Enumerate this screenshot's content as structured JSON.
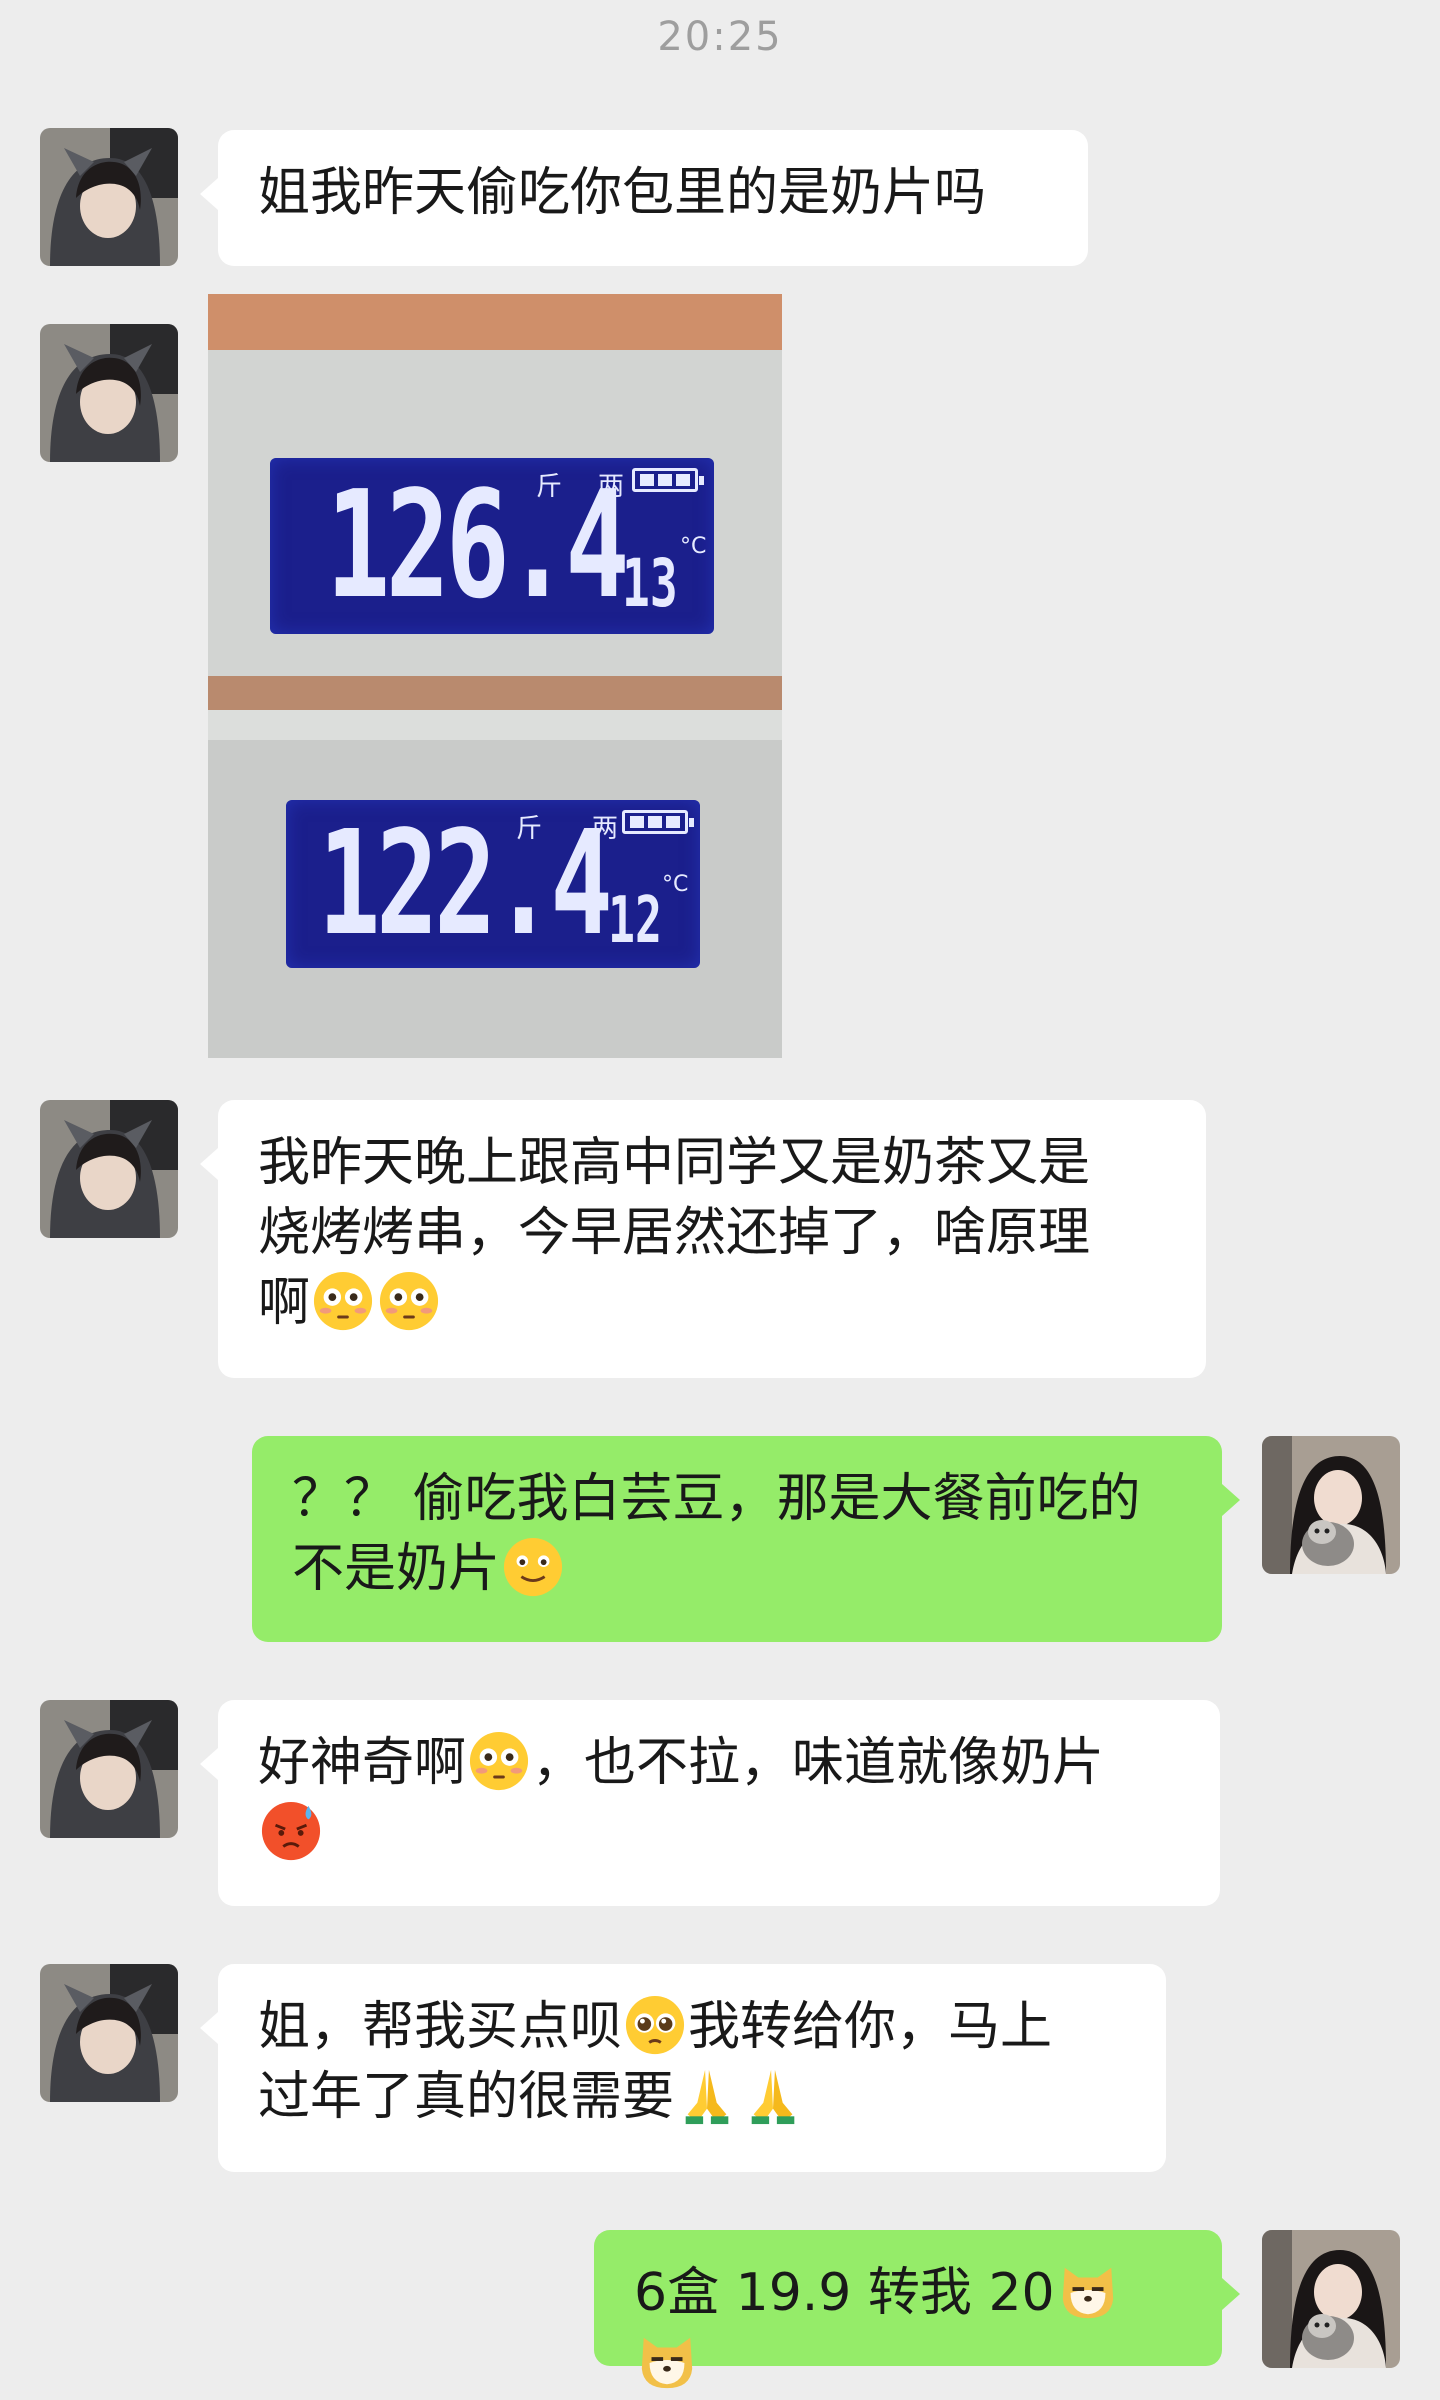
{
  "status": {
    "time": "20:25"
  },
  "colors": {
    "background": "#ededed",
    "incoming_bubble": "#ffffff",
    "outgoing_bubble": "#95ec69",
    "lcd_background": "#1b1f8c"
  },
  "messages": [
    {
      "side": "left",
      "text": "姐我昨天偷吃你包里的是奶片吗"
    },
    {
      "side": "left",
      "type": "image",
      "scale_readings": [
        {
          "weight": "126.4",
          "unit_jin": "斤",
          "unit_liang": "两",
          "temperature": "13",
          "temp_unit": "°C",
          "battery_level": 1.0
        },
        {
          "weight": "122.4",
          "unit_jin": "斤",
          "unit_liang": "两",
          "temperature": "12",
          "temp_unit": "°C",
          "battery_level": 1.0
        }
      ]
    },
    {
      "side": "left",
      "lines": [
        "我昨天晚上跟高中同学又是奶茶又是",
        "烧烤烤串，今早居然还掉了，啥原理",
        "啊"
      ],
      "emojis": [
        "flushed-face-icon",
        "flushed-face-icon"
      ]
    },
    {
      "side": "right",
      "lines": [
        "？？ 偷吃我白芸豆，那是大餐前吃的",
        "不是奶片"
      ],
      "emojis": [
        "slight-smile-face-icon"
      ]
    },
    {
      "side": "left",
      "parts": [
        "好神奇啊",
        "，也不拉，味道就像奶片"
      ],
      "emojis": [
        "flushed-face-icon",
        "angry-sweat-face-icon"
      ]
    },
    {
      "side": "left",
      "parts": [
        "姐，帮我买点呗",
        "我转给你，马上",
        "过年了真的很需要"
      ],
      "emojis": [
        "pleading-face-icon",
        "folded-hands-icon",
        "folded-hands-icon"
      ]
    },
    {
      "side": "right",
      "text": "6盒 19.9 转我 20",
      "emojis": [
        "doge-face-icon",
        "doge-face-icon"
      ]
    }
  ]
}
